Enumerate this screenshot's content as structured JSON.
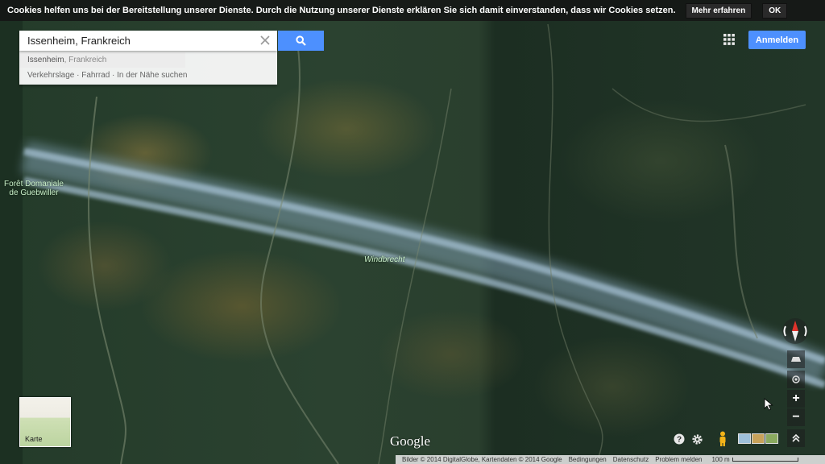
{
  "cookie_bar": {
    "text": "Cookies helfen uns bei der Bereitstellung unserer Dienste. Durch die Nutzung unserer Dienste erklären Sie sich damit einverstanden, dass wir Cookies setzen.",
    "more_label": "Mehr erfahren",
    "ok_label": "OK"
  },
  "search": {
    "value": "Issenheim, Frankreich",
    "suggestion_main": "Issenheim",
    "suggestion_sub": ", Frankreich",
    "suggestion_links": "Verkehrslage · Fahrrad · In der Nähe suchen"
  },
  "header": {
    "signin_label": "Anmelden"
  },
  "map": {
    "label_foret": "Forêt Domaniale de Guebwiller",
    "label_windbrecht": "Windbrecht",
    "karte_label": "Karte",
    "google_logo": "Google"
  },
  "controls": {
    "zoom_in": "+",
    "zoom_out": "−"
  },
  "footer": {
    "attribution": "Bilder © 2014 DigitalGlobe, Kartendaten © 2014 Google",
    "terms": "Bedingungen",
    "privacy": "Datenschutz",
    "report": "Problem melden",
    "scale": "100 m"
  },
  "colors": {
    "accent": "#4d90fe",
    "cookie_bg": "#1a1a1a"
  }
}
